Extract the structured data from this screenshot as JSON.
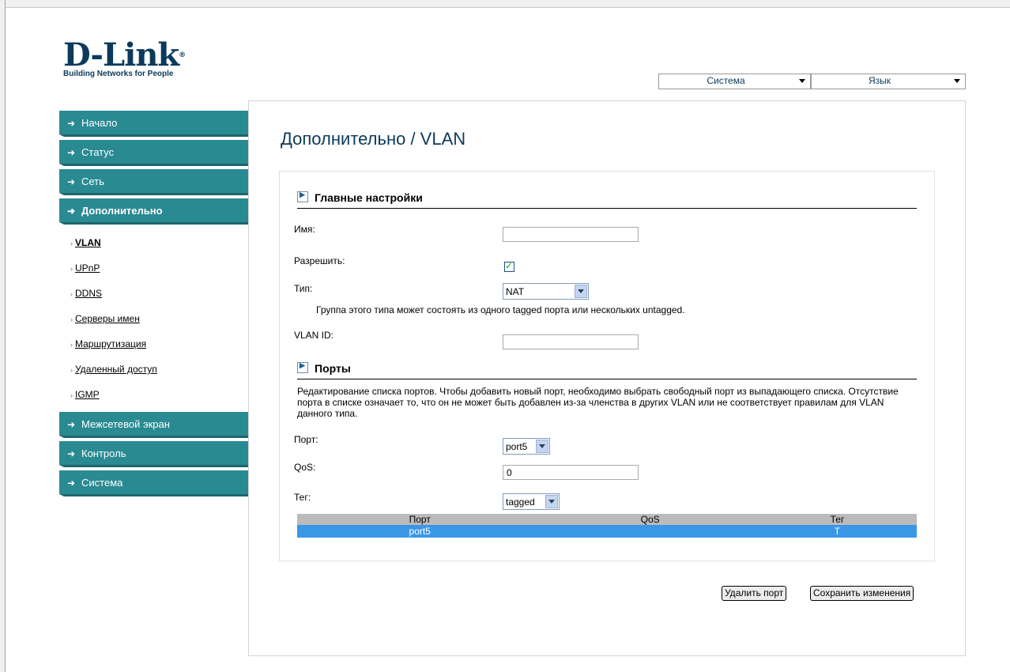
{
  "logo": {
    "name": "D-Link",
    "reg": "®",
    "tagline": "Building Networks for People"
  },
  "top_menu": {
    "system": "Система",
    "language": "Язык"
  },
  "sidebar": {
    "items": [
      {
        "label": "Начало"
      },
      {
        "label": "Статус"
      },
      {
        "label": "Сеть"
      },
      {
        "label": "Дополнительно"
      },
      {
        "label": "Межсетевой экран"
      },
      {
        "label": "Контроль"
      },
      {
        "label": "Система"
      }
    ],
    "subitems": [
      {
        "label": "VLAN"
      },
      {
        "label": "UPnP"
      },
      {
        "label": "DDNS"
      },
      {
        "label": "Серверы имен"
      },
      {
        "label": "Маршрутизация"
      },
      {
        "label": "Удаленный доступ"
      },
      {
        "label": "IGMP"
      }
    ]
  },
  "main": {
    "title": "Дополнительно / VLAN",
    "general": {
      "heading": "Главные настройки",
      "name_label": "Имя:",
      "name_value": "",
      "enable_label": "Разрешить:",
      "enable_checked": true,
      "type_label": "Тип:",
      "type_value": "NAT",
      "type_hint": "Группа этого типа может состоять из одного tagged порта или нескольких untagged.",
      "vlanid_label": "VLAN ID:",
      "vlanid_value": ""
    },
    "ports": {
      "heading": "Порты",
      "description": "Редактирование списка портов. Чтобы добавить новый порт, необходимо выбрать свободный порт из выпадающего списка. Отсутствие порта в списке означает то, что он не может быть добавлен из-за членства в других VLAN или не соответствует правилам для VLAN данного типа.",
      "port_label": "Порт:",
      "port_value": "port5",
      "qos_label": "QoS:",
      "qos_value": "0",
      "tag_label": "Тег:",
      "tag_value": "tagged",
      "table": {
        "columns": [
          "Порт",
          "QoS",
          "Тег"
        ],
        "rows": [
          [
            "port5",
            "",
            "T"
          ]
        ]
      }
    },
    "buttons": {
      "delete": "Удалить порт",
      "save": "Сохранить изменения"
    }
  },
  "colors": {
    "nav_bg": "#2a8a92",
    "title": "#0b3a5b",
    "row_selected": "#3a97e6"
  }
}
